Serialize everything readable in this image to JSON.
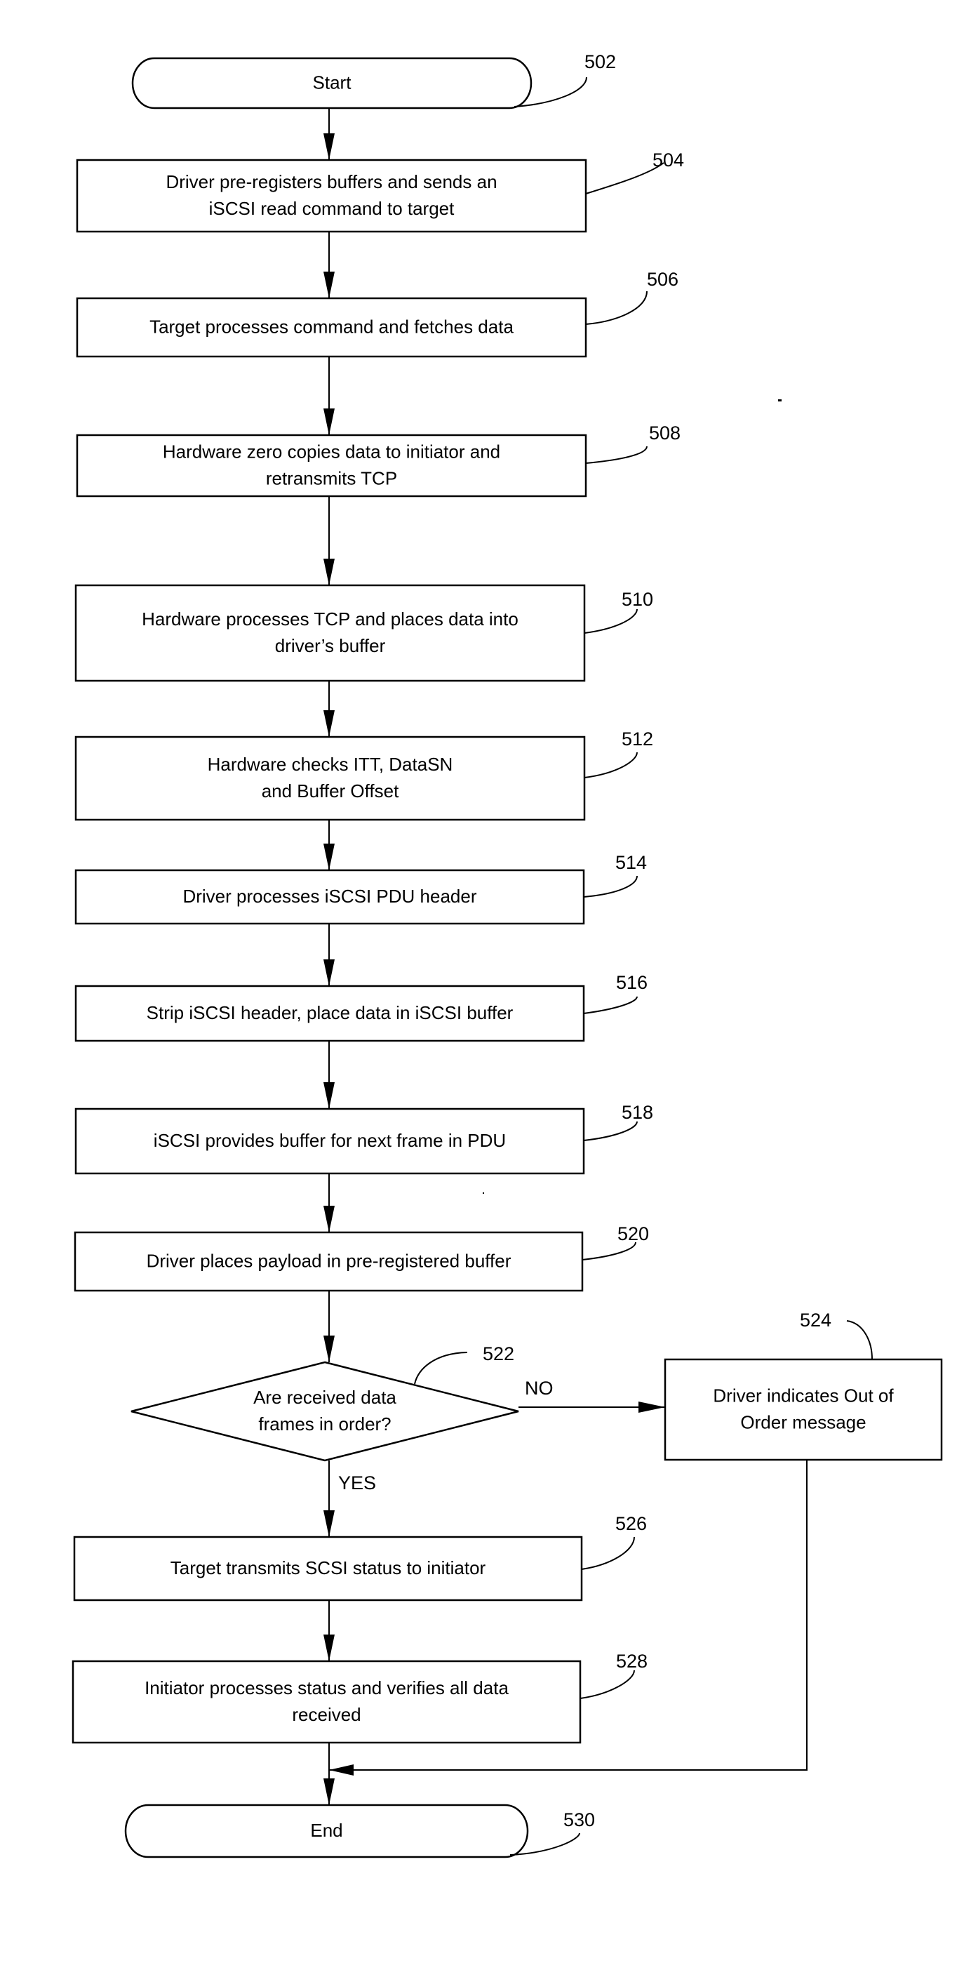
{
  "figure": {
    "nodes": [
      {
        "id": "502",
        "kind": "terminator",
        "lines": [
          "Start"
        ]
      },
      {
        "id": "504",
        "kind": "process",
        "lines": [
          "Driver pre-registers buffers and sends an",
          "iSCSI read command to target"
        ]
      },
      {
        "id": "506",
        "kind": "process",
        "lines": [
          "Target processes command and fetches data"
        ]
      },
      {
        "id": "508",
        "kind": "process",
        "lines": [
          "Hardware zero copies data to initiator and",
          "retransmits TCP"
        ]
      },
      {
        "id": "510",
        "kind": "process",
        "lines": [
          "Hardware processes TCP and places data into",
          "driver’s buffer"
        ]
      },
      {
        "id": "512",
        "kind": "process",
        "lines": [
          "Hardware checks ITT, DataSN",
          "and Buffer Offset"
        ]
      },
      {
        "id": "514",
        "kind": "process",
        "lines": [
          "Driver processes iSCSI PDU header"
        ]
      },
      {
        "id": "516",
        "kind": "process",
        "lines": [
          "Strip iSCSI header, place data in iSCSI buffer"
        ]
      },
      {
        "id": "518",
        "kind": "process",
        "lines": [
          "iSCSI provides buffer for next frame in PDU"
        ]
      },
      {
        "id": "520",
        "kind": "process",
        "lines": [
          "Driver places payload in pre-registered buffer"
        ]
      },
      {
        "id": "522",
        "kind": "decision",
        "lines": [
          "Are received data",
          "frames in order?"
        ]
      },
      {
        "id": "524",
        "kind": "process",
        "lines": [
          "Driver indicates Out of",
          "Order message"
        ]
      },
      {
        "id": "526",
        "kind": "process",
        "lines": [
          "Target transmits SCSI status to initiator"
        ]
      },
      {
        "id": "528",
        "kind": "process",
        "lines": [
          "Initiator processes status and verifies all data",
          "received"
        ]
      },
      {
        "id": "530",
        "kind": "terminator",
        "lines": [
          "End"
        ]
      }
    ],
    "edges": [
      {
        "from": "502",
        "to": "504"
      },
      {
        "from": "504",
        "to": "506"
      },
      {
        "from": "506",
        "to": "508"
      },
      {
        "from": "508",
        "to": "510"
      },
      {
        "from": "510",
        "to": "512"
      },
      {
        "from": "512",
        "to": "514"
      },
      {
        "from": "514",
        "to": "516"
      },
      {
        "from": "516",
        "to": "518"
      },
      {
        "from": "518",
        "to": "520"
      },
      {
        "from": "520",
        "to": "522"
      },
      {
        "from": "522",
        "to": "524",
        "label": "NO"
      },
      {
        "from": "522",
        "to": "526",
        "label": "YES"
      },
      {
        "from": "526",
        "to": "528"
      },
      {
        "from": "528",
        "to": "530"
      },
      {
        "from": "524",
        "to": "530"
      }
    ],
    "branch_labels": {
      "no": "NO",
      "yes": "YES"
    }
  }
}
